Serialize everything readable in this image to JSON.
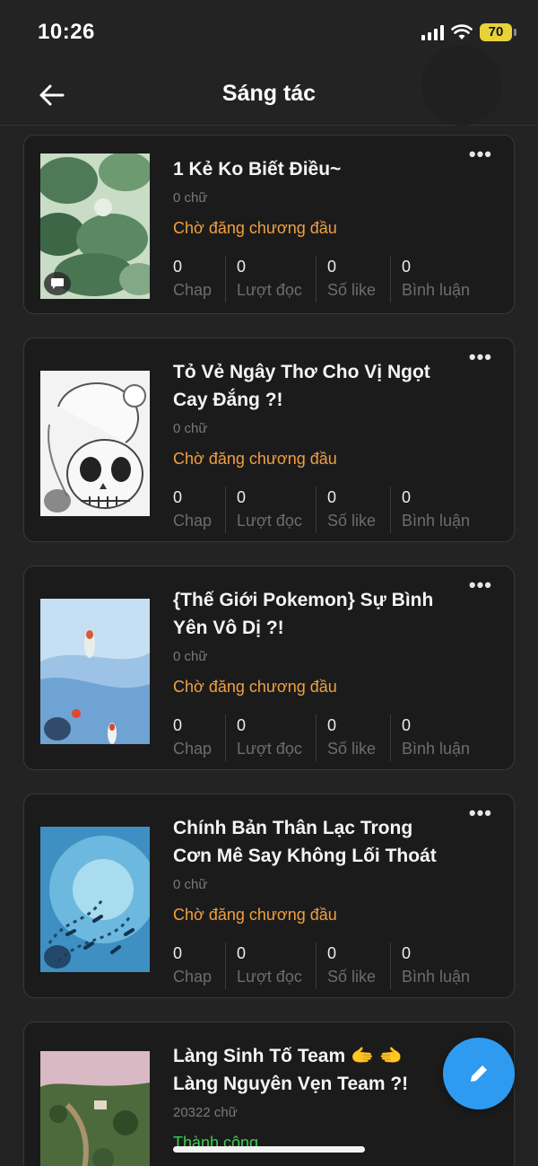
{
  "status_bar": {
    "time": "10:26",
    "battery": "70"
  },
  "header": {
    "title": "Sáng tác"
  },
  "stat_labels": {
    "chap": "Chap",
    "reads": "Lượt đọc",
    "likes": "Số like",
    "comments": "Bình luận"
  },
  "stories": [
    {
      "title_line1": "1 Kẻ Ko Biết Điều~",
      "title_line2": "",
      "words": "0 chữ",
      "status": "Chờ đăng chương đầu",
      "chap": "0",
      "reads": "0",
      "likes": "0",
      "comments": "0"
    },
    {
      "title_line1": "Tỏ Vẻ Ngây Thơ Cho Vị Ngọt",
      "title_line2": "Cay Đắng ?!",
      "words": "0 chữ",
      "status": "Chờ đăng chương đầu",
      "chap": "0",
      "reads": "0",
      "likes": "0",
      "comments": "0"
    },
    {
      "title_line1": "{Thế Giới Pokemon} Sự Bình",
      "title_line2": "Yên Vô Dị ?!",
      "words": "0 chữ",
      "status": "Chờ đăng chương đầu",
      "chap": "0",
      "reads": "0",
      "likes": "0",
      "comments": "0"
    },
    {
      "title_line1": "Chính Bản Thân Lạc Trong",
      "title_line2": "Cơn Mê Say Không Lối Thoát",
      "words": "0 chữ",
      "status": "Chờ đăng chương đầu",
      "chap": "0",
      "reads": "0",
      "likes": "0",
      "comments": "0"
    },
    {
      "title_line1": "Làng Sinh Tố Team 🫱 🫲",
      "title_line2": "Làng Nguyên Vẹn Team ?!",
      "words": "20322 chữ",
      "status": "Thành công"
    }
  ],
  "colors": {
    "pending": "#f0a040",
    "success": "#3ccf4e",
    "fab": "#2e9bf0"
  },
  "icons": {
    "back": "arrow-left-icon",
    "more": "more-horizontal-icon",
    "fab": "pencil-icon",
    "badge": "chat-bubble-icon"
  }
}
